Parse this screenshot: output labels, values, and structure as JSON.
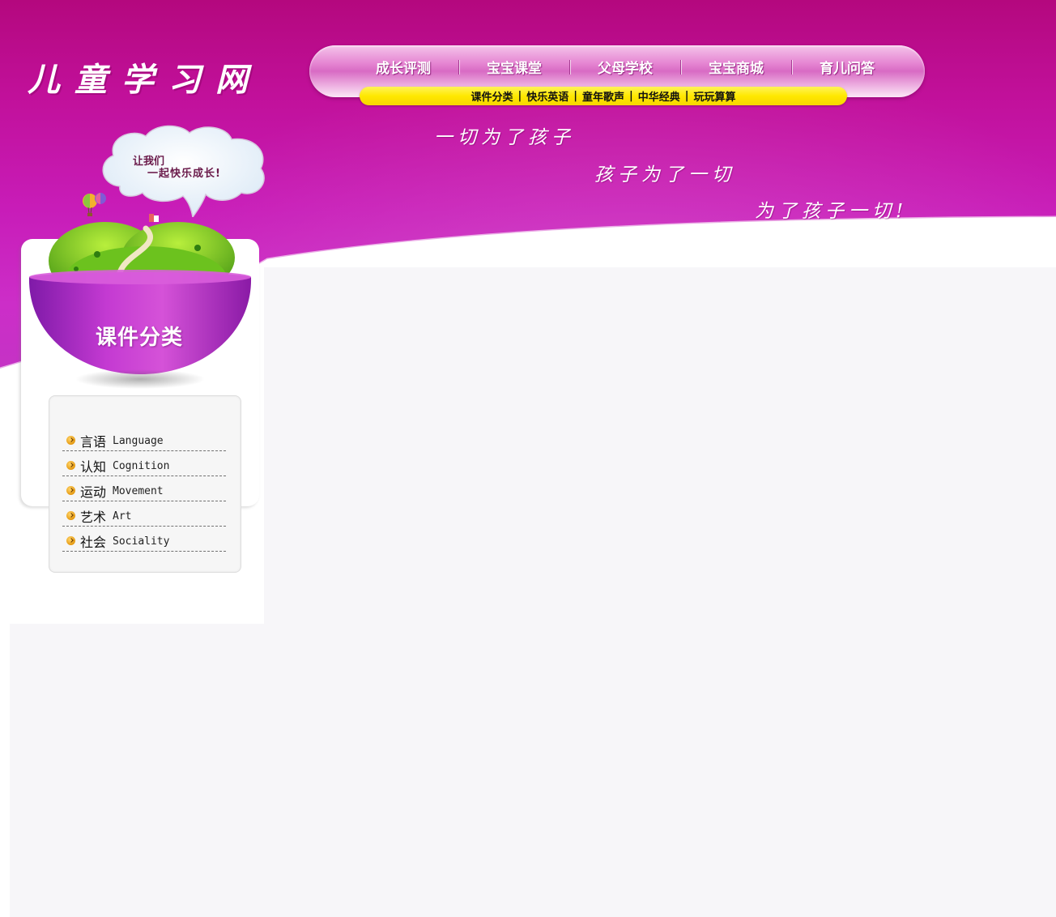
{
  "site": {
    "logo_text": "儿童学习网"
  },
  "main_nav": {
    "items": [
      "成长评测",
      "宝宝课堂",
      "父母学校",
      "宝宝商城",
      "育儿问答"
    ]
  },
  "sub_nav": {
    "items": [
      "课件分类",
      "快乐英语",
      "童年歌声",
      "中华经典",
      "玩玩算算"
    ],
    "separator": "|"
  },
  "slogans": [
    "一切为了孩子",
    "孩子为了一切",
    "为了孩子一切!"
  ],
  "cloud": {
    "line1": "让我们",
    "line2": "一起快乐成长!"
  },
  "category": {
    "title": "课件分类",
    "items": [
      {
        "cn": "言语",
        "en": "Language"
      },
      {
        "cn": "认知",
        "en": "Cognition"
      },
      {
        "cn": "运动",
        "en": "Movement"
      },
      {
        "cn": "艺术",
        "en": "Art"
      },
      {
        "cn": "社会",
        "en": "Sociality"
      }
    ]
  },
  "colors": {
    "banner": "#c11aa6",
    "sub_nav": "#ffe800",
    "bowl": "#b91ec4",
    "content_bg": "#f7f6f9"
  }
}
